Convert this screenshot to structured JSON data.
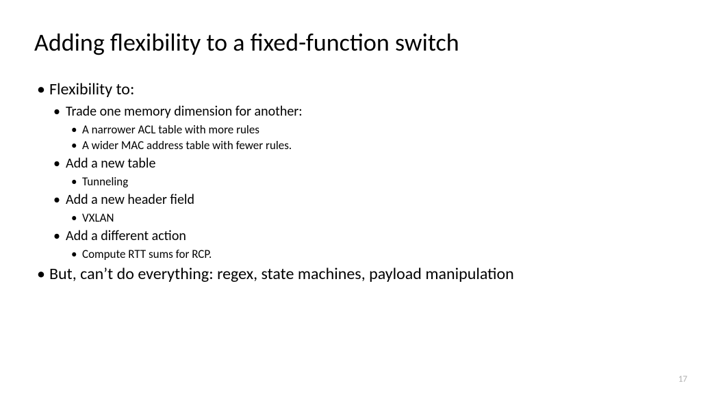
{
  "title": "Adding flexibility to a fixed-function switch",
  "bullets": {
    "b1": "Flexibility to:",
    "b1_1": "Trade one memory dimension for another:",
    "b1_1_1": "A narrower ACL table with more rules",
    "b1_1_2": "A wider MAC address table with fewer rules.",
    "b1_2": "Add a new table",
    "b1_2_1": "Tunneling",
    "b1_3": "Add a new header field",
    "b1_3_1": "VXLAN",
    "b1_4": "Add a different action",
    "b1_4_1": "Compute RTT sums for RCP.",
    "b2": "But, can’t do everything: regex, state machines, payload manipulation"
  },
  "pageNumber": "17"
}
